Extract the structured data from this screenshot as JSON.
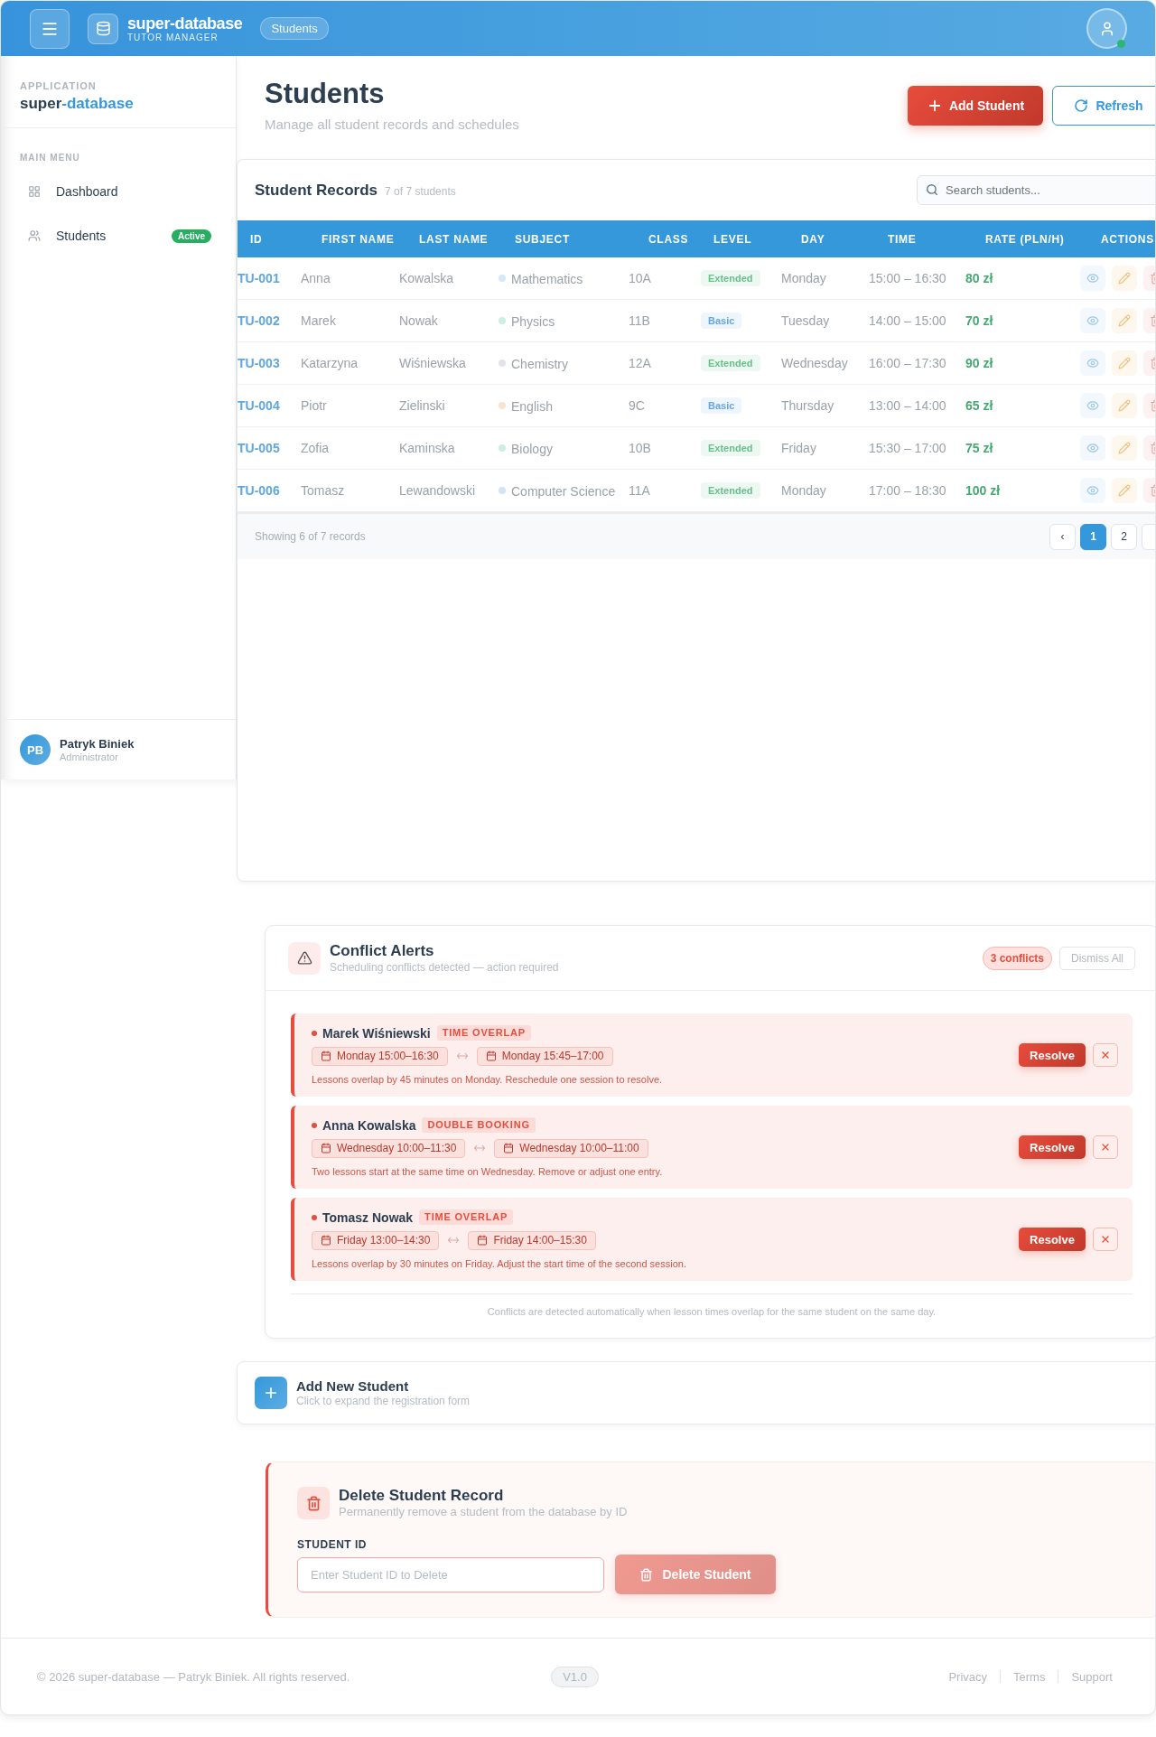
{
  "header": {
    "brand": "super-database",
    "tagline": "TUTOR MANAGER",
    "breadcrumb": "Students",
    "account": {
      "online": true
    }
  },
  "sidebar": {
    "section_label": "APPLICATION",
    "app_name": "super",
    "app_name_accent": "-database",
    "menu_label": "MAIN MENU",
    "items": [
      {
        "label": "Dashboard"
      },
      {
        "label": "Students",
        "badge": "Active"
      }
    ],
    "user": {
      "initials": "PB",
      "name": "Patryk Biniek",
      "role": "Administrator"
    }
  },
  "page": {
    "title": "Students",
    "subtitle": "Manage all student records and schedules",
    "actions": [
      {
        "label": "Add Student",
        "kind": "primary"
      },
      {
        "label": "Refresh",
        "kind": "outline"
      }
    ]
  },
  "table": {
    "title": "Student Records",
    "count": "7 of 7 students",
    "search": {
      "placeholder": "Search students..."
    },
    "columns": [
      "ID",
      "FIRST NAME",
      "LAST NAME",
      "SUBJECT",
      "CLASS",
      "LEVEL",
      "DAY",
      "TIME",
      "RATE (PLN/H)",
      "ACTIONS"
    ],
    "rows": [
      {
        "id": "TU-001",
        "first_name": "Anna",
        "last_name": "Kowalska",
        "subject": {
          "name": "Mathematics",
          "color": "#d5e8f7"
        },
        "class": "10A",
        "level": {
          "name": "Extended",
          "color": "#eef8f2"
        },
        "day": "Monday",
        "time": "15:00 – 16:30",
        "rate": "80 zł"
      },
      {
        "id": "TU-002",
        "first_name": "Marek",
        "last_name": "Nowak",
        "subject": {
          "name": "Physics",
          "color": "#cdeee3"
        },
        "class": "11B",
        "level": {
          "name": "Basic",
          "color": "#eef5fc"
        },
        "day": "Tuesday",
        "time": "14:00 – 15:00",
        "rate": "70 zł"
      },
      {
        "id": "TU-003",
        "first_name": "Katarzyna",
        "last_name": "Wiśniewska",
        "subject": {
          "name": "Chemistry",
          "color": "#e2e2ea"
        },
        "class": "12A",
        "level": {
          "name": "Extended",
          "color": "#eef8f2"
        },
        "day": "Wednesday",
        "time": "16:00 – 17:30",
        "rate": "90 zł"
      },
      {
        "id": "TU-004",
        "first_name": "Piotr",
        "last_name": "Zielinski",
        "subject": {
          "name": "English",
          "color": "#fbe2cd"
        },
        "class": "9C",
        "level": {
          "name": "Basic",
          "color": "#eef5fc"
        },
        "day": "Thursday",
        "time": "13:00 – 14:00",
        "rate": "65 zł"
      },
      {
        "id": "TU-005",
        "first_name": "Zofia",
        "last_name": "Kaminska",
        "subject": {
          "name": "Biology",
          "color": "#cdeee0"
        },
        "class": "10B",
        "level": {
          "name": "Extended",
          "color": "#eef8f2"
        },
        "day": "Friday",
        "time": "15:30 – 17:00",
        "rate": "75 zł"
      },
      {
        "id": "TU-006",
        "first_name": "Tomasz",
        "last_name": "Lewandowski",
        "subject": {
          "name": "Computer Science",
          "color": "#d3e3f2"
        },
        "class": "11A",
        "level": {
          "name": "Extended",
          "color": "#eef8f2"
        },
        "day": "Monday",
        "time": "17:00 – 18:30",
        "rate": "100 zł"
      }
    ],
    "summary": "Showing 6 of 7 records",
    "pagination": {
      "prev": "‹",
      "pages": [
        {
          "label": "1",
          "selected": true
        },
        {
          "label": "2",
          "selected": false
        }
      ]
    }
  },
  "conflicts": {
    "title": "Conflict Alerts",
    "subtitle": "Scheduling conflicts detected — action required",
    "count": "3 conflicts",
    "dismiss_all": "Dismiss All",
    "items": [
      {
        "name": "Marek Wiśniewski",
        "type": "TIME OVERLAP",
        "slots": [
          "Monday 15:00–16:30",
          "Monday 15:45–17:00"
        ],
        "message": "Lessons overlap by 45 minutes on Monday. Reschedule one session to resolve.",
        "action": "Resolve"
      },
      {
        "name": "Anna Kowalska",
        "type": "DOUBLE BOOKING",
        "slots": [
          "Wednesday 10:00–11:30",
          "Wednesday 10:00–11:00"
        ],
        "message": "Two lessons start at the same time on Wednesday. Remove or adjust one entry.",
        "action": "Resolve"
      },
      {
        "name": "Tomasz Nowak",
        "type": "TIME OVERLAP",
        "slots": [
          "Friday 13:00–14:30",
          "Friday 14:00–15:30"
        ],
        "message": "Lessons overlap by 30 minutes on Friday. Adjust the start time of the second session.",
        "action": "Resolve"
      }
    ],
    "note": "Conflicts are detected automatically when lesson times overlap for the same student on the same day."
  },
  "add_student": {
    "title": "Add New Student",
    "subtitle": "Click to expand the registration form"
  },
  "delete_record": {
    "title": "Delete Student Record",
    "subtitle": "Permanently remove a student from the database by ID",
    "field": {
      "label": "STUDENT ID",
      "placeholder": "Enter Student ID to Delete"
    },
    "button": {
      "label": "Delete Student",
      "disabled": true
    }
  },
  "footer": {
    "copyright": "© 2026 super-database — Patryk Biniek. All rights reserved.",
    "version": "V1.0",
    "links": [
      "Privacy",
      "Terms",
      "Support"
    ]
  }
}
